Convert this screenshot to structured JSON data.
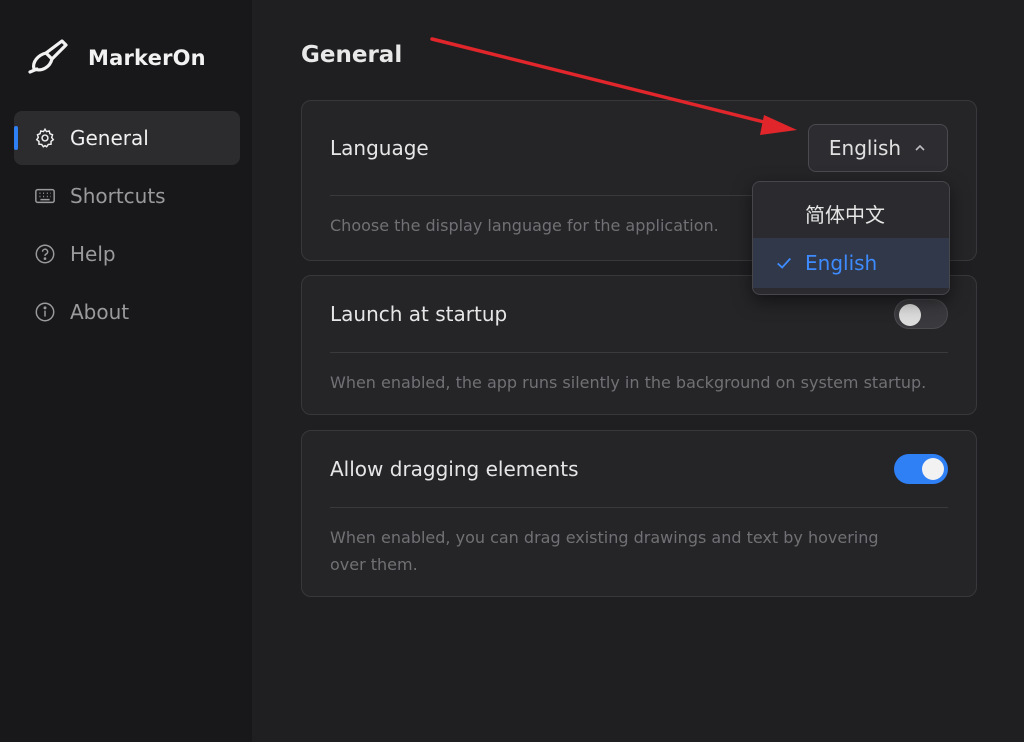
{
  "app": {
    "name": "MarkerOn"
  },
  "sidebar": {
    "items": [
      {
        "label": "General",
        "icon": "gear-icon",
        "active": true
      },
      {
        "label": "Shortcuts",
        "icon": "keyboard-icon",
        "active": false
      },
      {
        "label": "Help",
        "icon": "help-circle-icon",
        "active": false
      },
      {
        "label": "About",
        "icon": "info-circle-icon",
        "active": false
      }
    ]
  },
  "main": {
    "title": "General",
    "language": {
      "label": "Language",
      "selected": "English",
      "description": "Choose the display language for the application.",
      "options": [
        "简体中文",
        "English"
      ]
    },
    "startup": {
      "label": "Launch at startup",
      "enabled": false,
      "description": "When enabled, the app runs silently in the background on system startup."
    },
    "dragging": {
      "label": "Allow dragging elements",
      "enabled": true,
      "description": "When enabled, you can drag existing drawings and text by hovering over them."
    }
  },
  "colors": {
    "accent": "#2f7ff5",
    "annotation_arrow": "#e0262b",
    "background": "#1f1f21",
    "sidebar": "#18181a"
  }
}
